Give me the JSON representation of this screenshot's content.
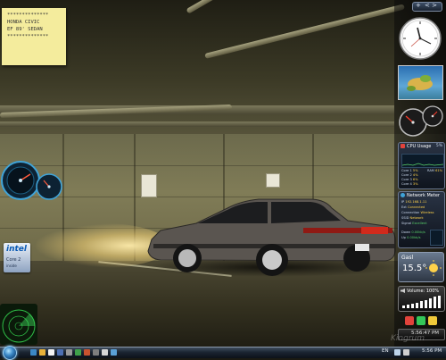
{
  "desktop": {
    "sticky_note": {
      "lines": [
        "**************",
        "HONDA CIVIC",
        "EF 89' SEDAN",
        "**************"
      ]
    },
    "intel_badge": {
      "brand": "intel",
      "product": "Core 2",
      "tagline": "inside"
    },
    "wallpaper_signs": {
      "sign_left": "NO PARKING ONLY"
    }
  },
  "sidebar": {
    "control": {
      "add": "+",
      "nav": "< >"
    },
    "cpu_meter": {
      "title": "CPU Usage",
      "value": "5%",
      "rows": [
        {
          "label": "Core 1",
          "value": "5%",
          "color": "#ffd24a"
        },
        {
          "label": "Core 2",
          "value": "4%",
          "color": "#ffd24a"
        },
        {
          "label": "Core 3",
          "value": "6%",
          "color": "#ffd24a"
        },
        {
          "label": "Core 4",
          "value": "3%",
          "color": "#ffd24a"
        },
        {
          "label": "RAM",
          "value": "61%",
          "color": "#ffd24a"
        }
      ]
    },
    "network_meter": {
      "title": "Network Meter",
      "rows": [
        {
          "label": "IP",
          "value": "192.168.1.11"
        },
        {
          "label": "Ext",
          "value": "Connected"
        },
        {
          "label": "Connection",
          "value": "Wireless"
        },
        {
          "label": "SSID",
          "value": "Network"
        },
        {
          "label": "Signal",
          "value": "Excellent"
        },
        {
          "label": "Down",
          "value": "0.00kb/s"
        },
        {
          "label": "Up",
          "value": "0.00kb/s"
        }
      ]
    },
    "weather": {
      "city": "Gasl",
      "temperature": "15.5°"
    },
    "volume": {
      "label": "Volume: 100%",
      "level": 1.0
    },
    "time_gadget": {
      "text": "5:56:47 PM"
    },
    "colors": {
      "accent": "#3b88c6",
      "panel_border": "#6b7890",
      "green": "#34c759",
      "red": "#e2433b",
      "yellow": "#f0c93a"
    }
  },
  "watermark": {
    "text": "Kingrum"
  },
  "taskbar": {
    "language": "EN",
    "clock": "5:56 PM",
    "start_label": "Start"
  },
  "icons": [
    "start-orb-icon",
    "internet-explorer-icon",
    "folder-icon",
    "media-player-icon",
    "speaker-icon",
    "network-icon"
  ]
}
